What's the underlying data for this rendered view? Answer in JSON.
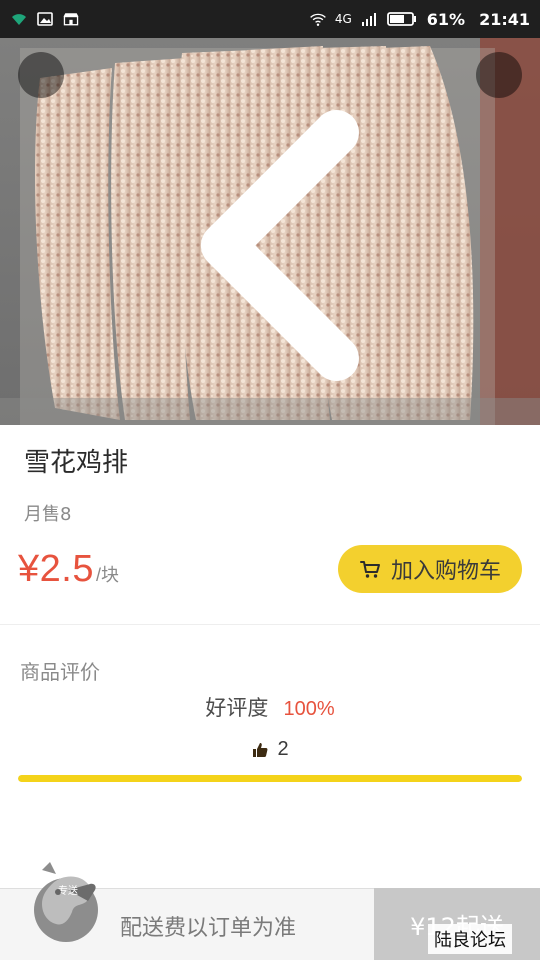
{
  "status_bar": {
    "network": "4G",
    "battery": "61%",
    "time": "21:41",
    "icons": [
      "wifi-icon",
      "image-icon",
      "store-icon",
      "wifi-icon",
      "signal-icon",
      "battery-icon"
    ]
  },
  "product": {
    "name": "雪花鸡排",
    "monthly_sales": "月售8",
    "price": "¥2.5",
    "unit": "/块",
    "add_to_cart": "加入购物车"
  },
  "reviews": {
    "title": "商品评价",
    "rating_label": "好评度",
    "rating_value": "100%",
    "likes": "2",
    "rating_fraction": 1.0
  },
  "bottom": {
    "delivery_note": "配送费以订单为准",
    "min_order": "¥12起送",
    "mascot_tag": "专送",
    "watermark": "陆良论坛"
  },
  "colors": {
    "accent": "#f3d02e",
    "price": "#e7533e",
    "bar": "#f4d31a",
    "status_bar": "#1f1f1f"
  }
}
